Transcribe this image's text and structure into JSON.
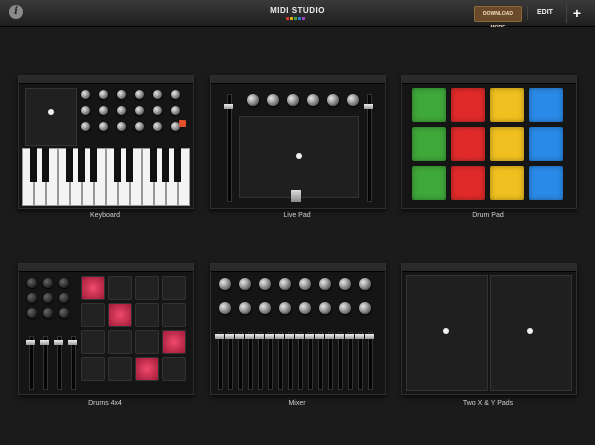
{
  "header": {
    "title": "MIDI STUDIO",
    "download_label": "DOWNLOAD MORE",
    "edit_label": "EDIT",
    "add_label": "+",
    "info_label": "i",
    "logo_colors": [
      "#d03a2a",
      "#e2a81e",
      "#3aa34a",
      "#2a7ad0",
      "#9a4ac0"
    ]
  },
  "presets": [
    {
      "name": "Keyboard"
    },
    {
      "name": "Live Pad"
    },
    {
      "name": "Drum Pad"
    },
    {
      "name": "Drums 4x4"
    },
    {
      "name": "Mixer"
    },
    {
      "name": "Two X & Y Pads"
    }
  ],
  "drum_pad_colors": [
    "#3fa83a",
    "#e02a2a",
    "#f0c020",
    "#2a8ae8"
  ]
}
